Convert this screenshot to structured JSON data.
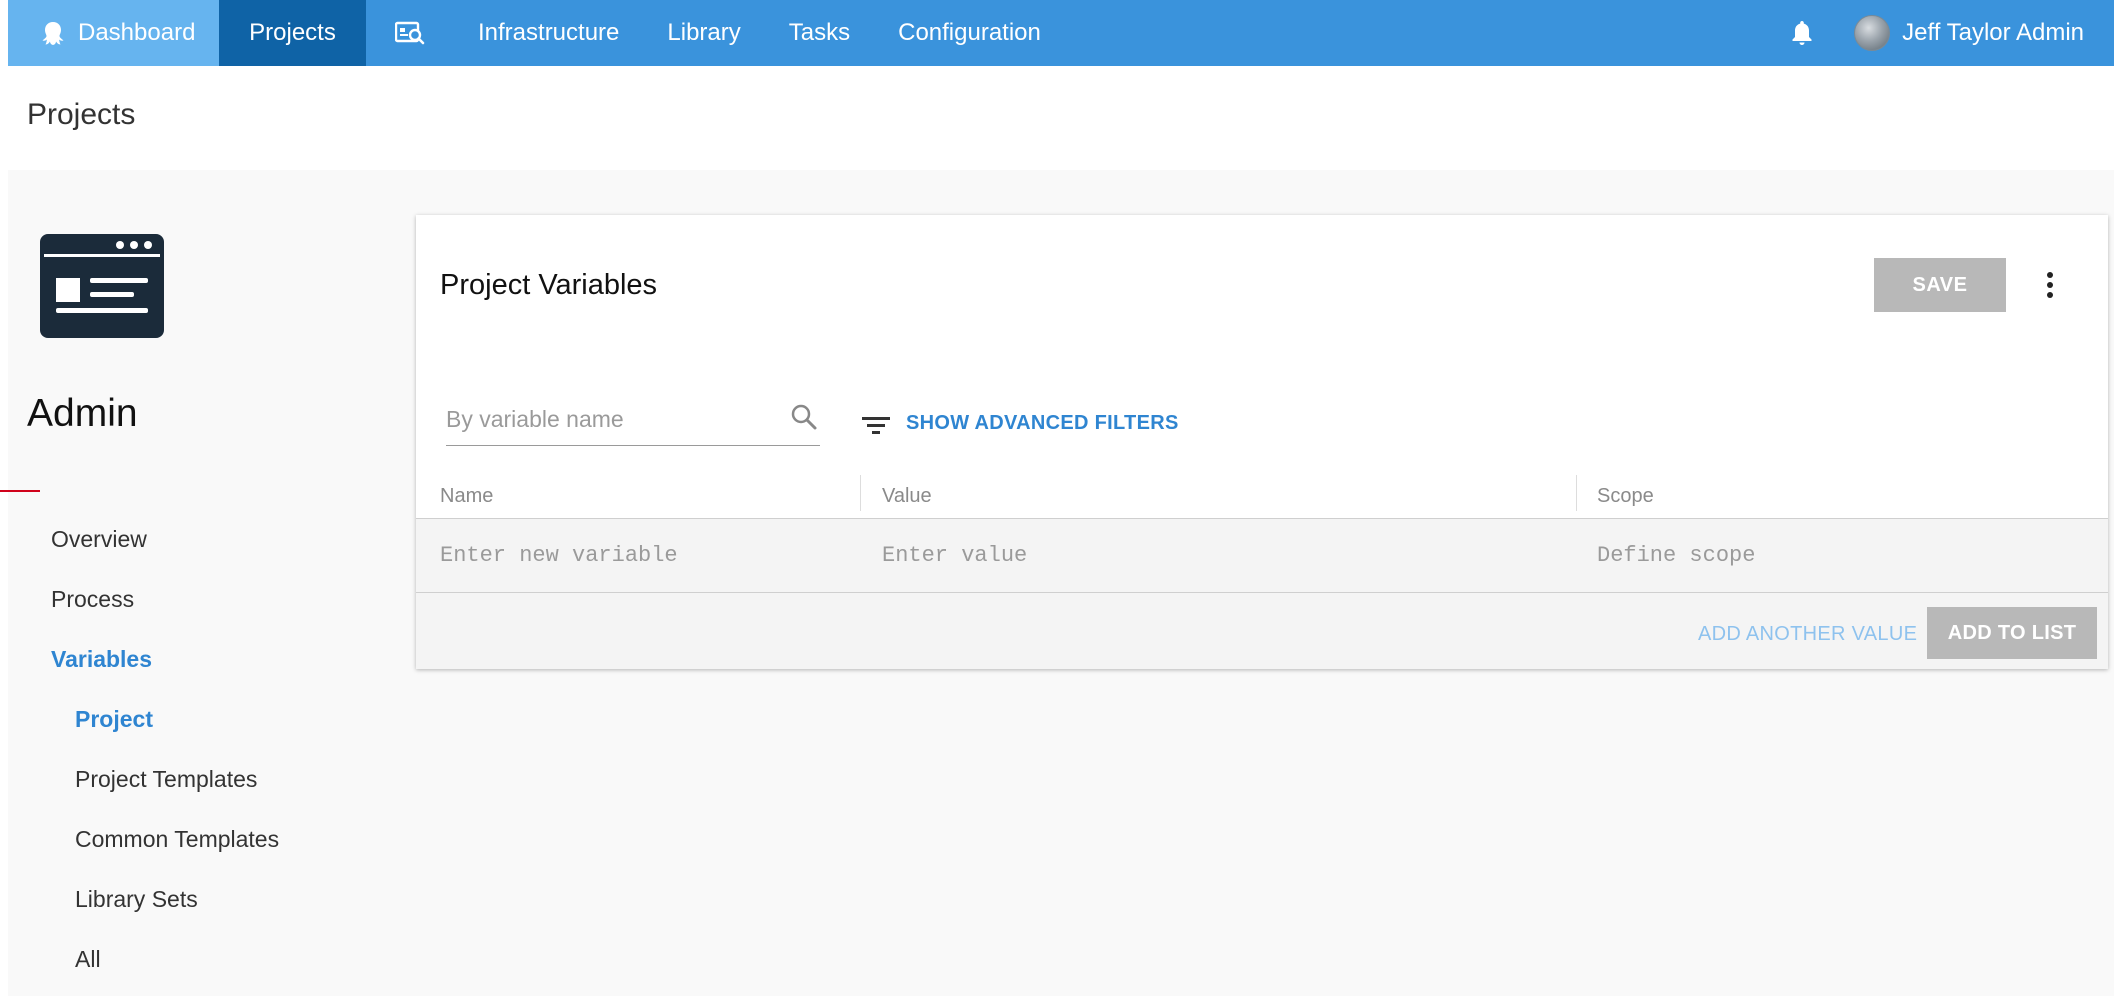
{
  "nav": {
    "dashboard": "Dashboard",
    "projects": "Projects",
    "infrastructure": "Infrastructure",
    "library": "Library",
    "tasks": "Tasks",
    "configuration": "Configuration",
    "user_name": "Jeff Taylor Admin"
  },
  "page": {
    "title": "Projects"
  },
  "project": {
    "name": "Admin"
  },
  "sidebar": {
    "items": [
      {
        "label": "Overview"
      },
      {
        "label": "Process"
      },
      {
        "label": "Variables"
      },
      {
        "label": "Project"
      },
      {
        "label": "Project Templates"
      },
      {
        "label": "Common Templates"
      },
      {
        "label": "Library Sets"
      },
      {
        "label": "All"
      }
    ],
    "active": "Variables",
    "active_sub": "Project"
  },
  "variables": {
    "title": "Project Variables",
    "save_label": "SAVE",
    "search_placeholder": "By variable name",
    "advanced_filters_label": "SHOW ADVANCED FILTERS",
    "columns": [
      "Name",
      "Value",
      "Scope"
    ],
    "new_row": {
      "name_placeholder": "Enter new variable",
      "value_placeholder": "Enter value",
      "scope_placeholder": "Define scope"
    },
    "add_another_label": "ADD ANOTHER VALUE",
    "add_to_list_label": "ADD TO LIST"
  },
  "colors": {
    "nav_bg": "#3a93dc",
    "nav_active": "#0f63a6",
    "nav_dashboard": "#66b4ef",
    "accent": "#2f85d1",
    "disabled_button": "#b8b8b8",
    "active_marker": "#d0021b"
  },
  "icons": [
    "octopus-logo-icon",
    "search-dashboard-icon",
    "bell-icon",
    "avatar",
    "project-logo-icon",
    "search-icon",
    "filter-icon",
    "more-vertical-icon"
  ]
}
